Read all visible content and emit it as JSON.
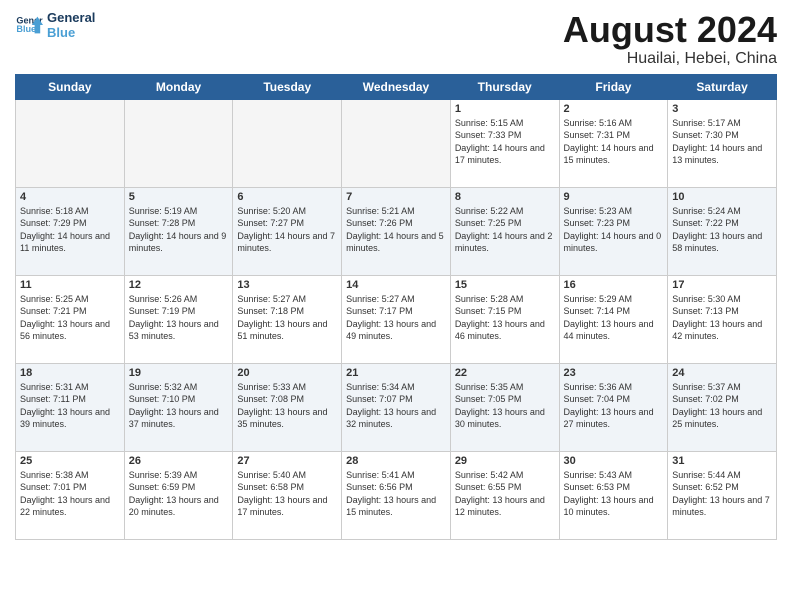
{
  "logo": {
    "line1": "General",
    "line2": "Blue"
  },
  "title": "August 2024",
  "subtitle": "Huailai, Hebei, China",
  "days": [
    "Sunday",
    "Monday",
    "Tuesday",
    "Wednesday",
    "Thursday",
    "Friday",
    "Saturday"
  ],
  "weeks": [
    [
      {
        "day": "",
        "info": ""
      },
      {
        "day": "",
        "info": ""
      },
      {
        "day": "",
        "info": ""
      },
      {
        "day": "",
        "info": ""
      },
      {
        "day": "1",
        "info": "Sunrise: 5:15 AM\nSunset: 7:33 PM\nDaylight: 14 hours and 17 minutes."
      },
      {
        "day": "2",
        "info": "Sunrise: 5:16 AM\nSunset: 7:31 PM\nDaylight: 14 hours and 15 minutes."
      },
      {
        "day": "3",
        "info": "Sunrise: 5:17 AM\nSunset: 7:30 PM\nDaylight: 14 hours and 13 minutes."
      }
    ],
    [
      {
        "day": "4",
        "info": "Sunrise: 5:18 AM\nSunset: 7:29 PM\nDaylight: 14 hours and 11 minutes."
      },
      {
        "day": "5",
        "info": "Sunrise: 5:19 AM\nSunset: 7:28 PM\nDaylight: 14 hours and 9 minutes."
      },
      {
        "day": "6",
        "info": "Sunrise: 5:20 AM\nSunset: 7:27 PM\nDaylight: 14 hours and 7 minutes."
      },
      {
        "day": "7",
        "info": "Sunrise: 5:21 AM\nSunset: 7:26 PM\nDaylight: 14 hours and 5 minutes."
      },
      {
        "day": "8",
        "info": "Sunrise: 5:22 AM\nSunset: 7:25 PM\nDaylight: 14 hours and 2 minutes."
      },
      {
        "day": "9",
        "info": "Sunrise: 5:23 AM\nSunset: 7:23 PM\nDaylight: 14 hours and 0 minutes."
      },
      {
        "day": "10",
        "info": "Sunrise: 5:24 AM\nSunset: 7:22 PM\nDaylight: 13 hours and 58 minutes."
      }
    ],
    [
      {
        "day": "11",
        "info": "Sunrise: 5:25 AM\nSunset: 7:21 PM\nDaylight: 13 hours and 56 minutes."
      },
      {
        "day": "12",
        "info": "Sunrise: 5:26 AM\nSunset: 7:19 PM\nDaylight: 13 hours and 53 minutes."
      },
      {
        "day": "13",
        "info": "Sunrise: 5:27 AM\nSunset: 7:18 PM\nDaylight: 13 hours and 51 minutes."
      },
      {
        "day": "14",
        "info": "Sunrise: 5:27 AM\nSunset: 7:17 PM\nDaylight: 13 hours and 49 minutes."
      },
      {
        "day": "15",
        "info": "Sunrise: 5:28 AM\nSunset: 7:15 PM\nDaylight: 13 hours and 46 minutes."
      },
      {
        "day": "16",
        "info": "Sunrise: 5:29 AM\nSunset: 7:14 PM\nDaylight: 13 hours and 44 minutes."
      },
      {
        "day": "17",
        "info": "Sunrise: 5:30 AM\nSunset: 7:13 PM\nDaylight: 13 hours and 42 minutes."
      }
    ],
    [
      {
        "day": "18",
        "info": "Sunrise: 5:31 AM\nSunset: 7:11 PM\nDaylight: 13 hours and 39 minutes."
      },
      {
        "day": "19",
        "info": "Sunrise: 5:32 AM\nSunset: 7:10 PM\nDaylight: 13 hours and 37 minutes."
      },
      {
        "day": "20",
        "info": "Sunrise: 5:33 AM\nSunset: 7:08 PM\nDaylight: 13 hours and 35 minutes."
      },
      {
        "day": "21",
        "info": "Sunrise: 5:34 AM\nSunset: 7:07 PM\nDaylight: 13 hours and 32 minutes."
      },
      {
        "day": "22",
        "info": "Sunrise: 5:35 AM\nSunset: 7:05 PM\nDaylight: 13 hours and 30 minutes."
      },
      {
        "day": "23",
        "info": "Sunrise: 5:36 AM\nSunset: 7:04 PM\nDaylight: 13 hours and 27 minutes."
      },
      {
        "day": "24",
        "info": "Sunrise: 5:37 AM\nSunset: 7:02 PM\nDaylight: 13 hours and 25 minutes."
      }
    ],
    [
      {
        "day": "25",
        "info": "Sunrise: 5:38 AM\nSunset: 7:01 PM\nDaylight: 13 hours and 22 minutes."
      },
      {
        "day": "26",
        "info": "Sunrise: 5:39 AM\nSunset: 6:59 PM\nDaylight: 13 hours and 20 minutes."
      },
      {
        "day": "27",
        "info": "Sunrise: 5:40 AM\nSunset: 6:58 PM\nDaylight: 13 hours and 17 minutes."
      },
      {
        "day": "28",
        "info": "Sunrise: 5:41 AM\nSunset: 6:56 PM\nDaylight: 13 hours and 15 minutes."
      },
      {
        "day": "29",
        "info": "Sunrise: 5:42 AM\nSunset: 6:55 PM\nDaylight: 13 hours and 12 minutes."
      },
      {
        "day": "30",
        "info": "Sunrise: 5:43 AM\nSunset: 6:53 PM\nDaylight: 13 hours and 10 minutes."
      },
      {
        "day": "31",
        "info": "Sunrise: 5:44 AM\nSunset: 6:52 PM\nDaylight: 13 hours and 7 minutes."
      }
    ]
  ],
  "colors": {
    "header_bg": "#2a6099",
    "header_text": "#ffffff",
    "alt_row_bg": "#f0f4f8"
  }
}
